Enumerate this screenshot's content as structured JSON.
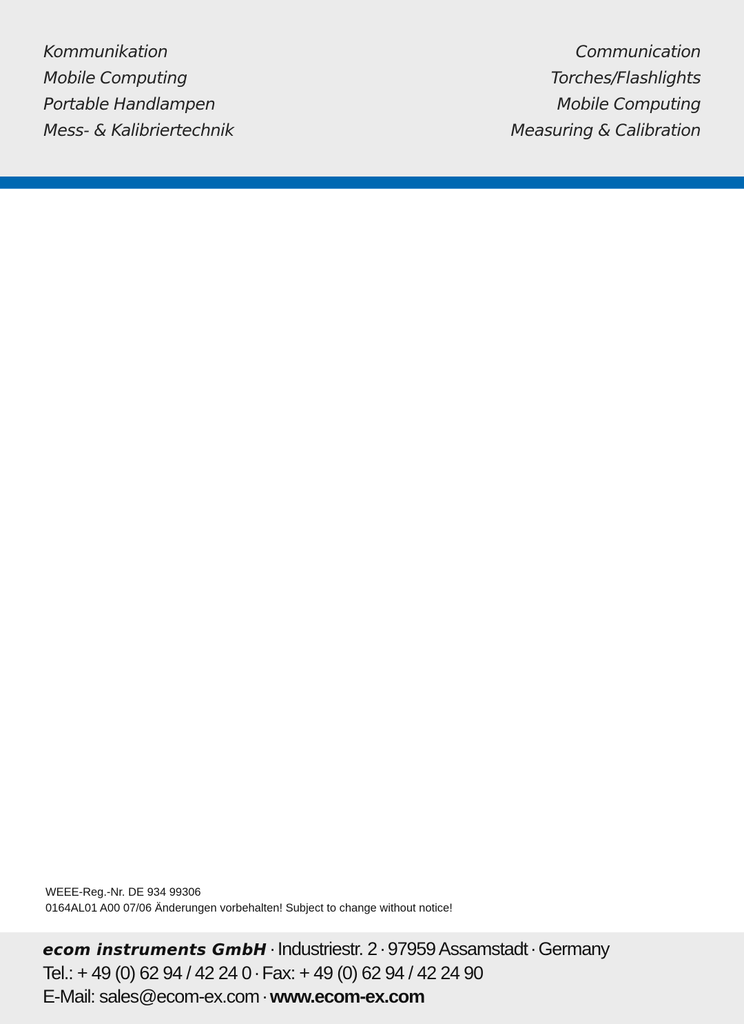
{
  "header": {
    "left_items": [
      "Kommunikation",
      "Mobile Computing",
      "Portable Handlampen",
      "Mess- & Kalibriertechnik"
    ],
    "right_items": [
      "Communication",
      "Torches/Flashlights",
      "Mobile Computing",
      "Measuring & Calibration"
    ]
  },
  "colors": {
    "band_gray": "#ebebeb",
    "accent_blue": "#0068b2"
  },
  "notes": {
    "weee": "WEEE-Reg.-Nr. DE 934 99306",
    "disclaimer": "0164AL01 A00 07/06 Änderungen vorbehalten! Subject to change without notice!"
  },
  "footer": {
    "company": "ecom instruments GmbH",
    "separator": "·",
    "street": "Industriestr. 2",
    "city": "97959 Assamstadt",
    "country": "Germany",
    "tel": "Tel.: + 49 (0) 62 94 / 42 24 0",
    "fax": "Fax: + 49 (0) 62 94 / 42 24 90",
    "email": "E-Mail: sales@ecom-ex.com",
    "website": "www.ecom-ex.com"
  }
}
